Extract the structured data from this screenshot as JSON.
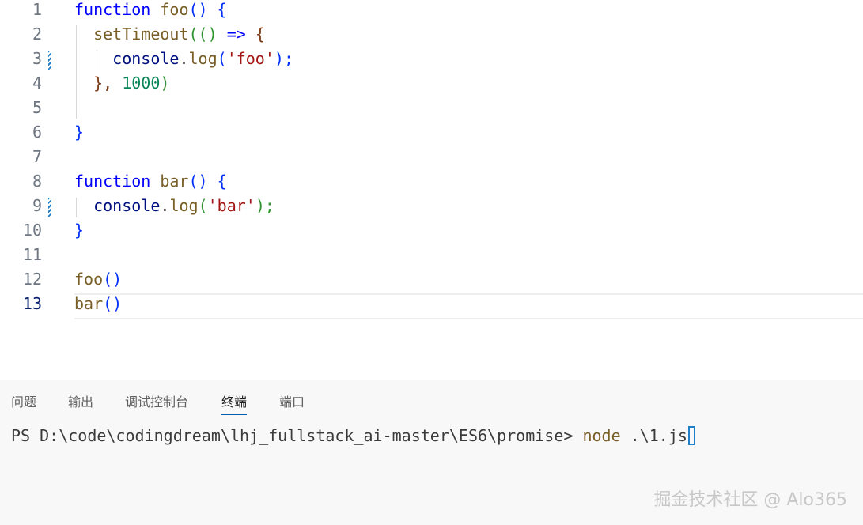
{
  "editor": {
    "line_numbers": [
      "1",
      "2",
      "3",
      "4",
      "5",
      "6",
      "7",
      "8",
      "9",
      "10",
      "11",
      "12",
      "13"
    ],
    "current_line": "13",
    "tokens": {
      "l1": [
        "function",
        "foo",
        "()",
        " {"
      ],
      "l2": [
        "setTimeout",
        "((",
        ")",
        " =>",
        " {"
      ],
      "l3": [
        "console",
        ".",
        "log",
        "(",
        "'foo'",
        ");"
      ],
      "l4": [
        "},",
        " 1000",
        ")"
      ],
      "l6": [
        "}"
      ],
      "l8": [
        "function",
        "bar",
        "()",
        " {"
      ],
      "l9": [
        "console",
        ".",
        "log",
        "(",
        "'bar'",
        ");"
      ],
      "l10": [
        "}"
      ],
      "l12": [
        "foo",
        "()"
      ],
      "l13": [
        "bar",
        "()"
      ]
    }
  },
  "panel": {
    "tabs": [
      "问题",
      "输出",
      "调试控制台",
      "终端",
      "端口"
    ],
    "active_tab": "终端",
    "terminal": {
      "prompt": "PS D:\\code\\codingdream\\lhj_fullstack_ai-master\\ES6\\promise> ",
      "command": "node",
      "argument": " .\\1.js"
    }
  },
  "watermark": "掘金技术社区 @ Alo365",
  "colors": {
    "keyword": "#0000ff",
    "function": "#795e26",
    "string": "#a31515",
    "number": "#098658",
    "variable": "#001080",
    "cursor": "#1f7fc9",
    "active_tab_underline": "#005fb8"
  }
}
